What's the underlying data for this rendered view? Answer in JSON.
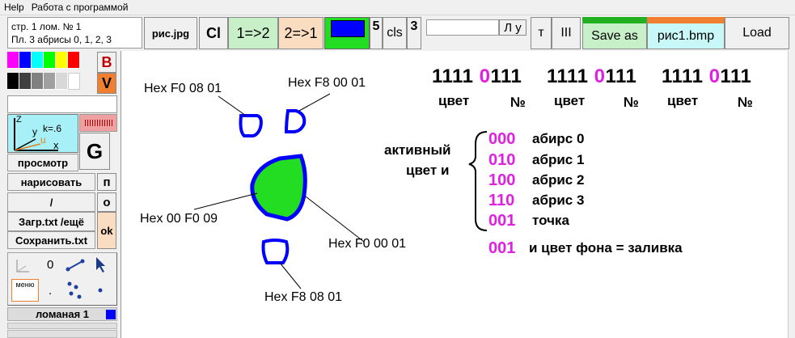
{
  "menu": {
    "help": "Help",
    "work": "Работа с программой"
  },
  "status": {
    "line1": "стр. 1 лом.  № 1",
    "line2": "Пл. 3  абрисы 0, 1, 2, 3"
  },
  "toolbar": {
    "file_name": "рис.jpg",
    "cl": "Cl",
    "one_to_two": "1=>2",
    "two_to_one": "2=>1",
    "num5": "5",
    "cls": "cls",
    "num3": "3",
    "lu": "Л у",
    "t": "т",
    "iii": "III",
    "save_as": "Save as",
    "out_file": "рис1.bmp",
    "load": "Load"
  },
  "colors": {
    "palette_row1": [
      "#ff00ff",
      "#0000ff",
      "#00ffff",
      "#00ff00",
      "#ffff00",
      "#ff0000"
    ],
    "palette_row2": [
      "#000000",
      "#404040",
      "#808080",
      "#a0a0a0",
      "#d8d8d8",
      "#ffffff"
    ],
    "accent_orange": "#f08030",
    "accent_green": "#c8f0c8",
    "selected_color": "#0000ff",
    "pink": "#e020e0",
    "shape_stroke": "#0000ff",
    "shape_fill": "#22dd22"
  },
  "left": {
    "b": "B",
    "v": "V",
    "axes_z": "Z",
    "axes_y": "y",
    "axes_x": "x",
    "axes_u": "u",
    "axes_k": "k=.6",
    "g": "G",
    "preview": "просмотр",
    "draw": "нарисовать",
    "p": "п",
    "slash": "/",
    "o": "о",
    "load_txt": "Загр.txt /ещё",
    "save_txt": "Сохранить.txt",
    "ok": "ok",
    "zero": "0",
    "menu": "меню",
    "dot": ".",
    "polyline": "ломаная  1"
  },
  "canvas": {
    "hex_top_left": "Hex F0  08  01",
    "hex_top_right": "Hex F8  00  01",
    "hex_center": "Hex 00  F0  09",
    "hex_right": "Hex F0  00  01",
    "hex_bottom": "Hex F8  08  01",
    "groups": [
      {
        "first": "1111",
        "pink": "0",
        "rest": "111",
        "color_label": "цвет",
        "num_label": "№"
      },
      {
        "first": "1111",
        "pink": "0",
        "rest": "111",
        "color_label": "цвет",
        "num_label": "№"
      },
      {
        "first": "1111",
        "pink": "0",
        "rest": "111",
        "color_label": "цвет",
        "num_label": "№"
      }
    ],
    "active_line1": "активный",
    "active_line2": "цвет и",
    "legend": [
      {
        "code": "000",
        "text": "абирс 0"
      },
      {
        "code": "010",
        "text": "абрис 1"
      },
      {
        "code": "100",
        "text": "абрис 2"
      },
      {
        "code": "110",
        "text": "абрис 3"
      },
      {
        "code": "001",
        "text": "точка"
      }
    ],
    "fill_code": "001",
    "fill_text": "и цвет фона = заливка"
  }
}
